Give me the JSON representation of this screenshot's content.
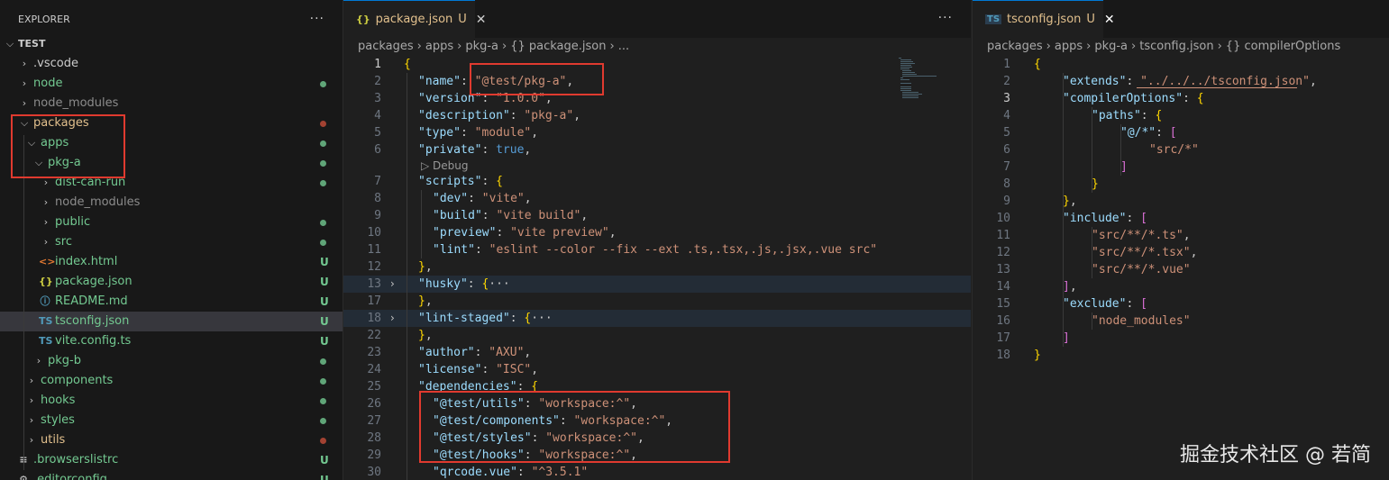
{
  "explorer": {
    "title": "EXPLORER",
    "more": "···",
    "root": "TEST",
    "items": [
      {
        "label": "node",
        "status": "dot"
      },
      {
        "label": "node_modules",
        "status": ""
      },
      {
        "label": "packages",
        "status": "dot"
      },
      {
        "label": "apps",
        "status": "dot"
      },
      {
        "label": "pkg-a",
        "status": "dot"
      },
      {
        "label": "dist-can-run",
        "status": "dot"
      },
      {
        "label": "node_modules",
        "status": ""
      },
      {
        "label": "public",
        "status": "dot"
      },
      {
        "label": "src",
        "status": "dot"
      },
      {
        "label": "index.html",
        "status": "U"
      },
      {
        "label": "package.json",
        "status": "U"
      },
      {
        "label": "README.md",
        "status": "U"
      },
      {
        "label": "tsconfig.json",
        "status": "U"
      },
      {
        "label": "vite.config.ts",
        "status": "U"
      },
      {
        "label": "pkg-b",
        "status": "dot"
      },
      {
        "label": "components",
        "status": "dot"
      },
      {
        "label": "hooks",
        "status": "dot"
      },
      {
        "label": "styles",
        "status": "dot"
      },
      {
        "label": "utils",
        "status": "dot"
      },
      {
        "label": ".browserslistrc",
        "status": "U"
      },
      {
        "label": ".editorconfig",
        "status": "U"
      }
    ],
    "vscode": ".vscode"
  },
  "left_editor": {
    "tab": {
      "icon": "{}",
      "name": "package.json",
      "status": "U",
      "close": "✕"
    },
    "more": "···",
    "breadcrumb": [
      "packages",
      "apps",
      "pkg-a",
      "{} package.json",
      "..."
    ],
    "codelens": "▷ Debug",
    "lines": [
      {
        "n": "1",
        "t": "{"
      },
      {
        "n": "2",
        "t": "\"name\": \"@test/pkg-a\","
      },
      {
        "n": "3",
        "t": "\"version\": \"1.0.0\","
      },
      {
        "n": "4",
        "t": "\"description\": \"pkg-a\","
      },
      {
        "n": "5",
        "t": "\"type\": \"module\","
      },
      {
        "n": "6",
        "t": "\"private\": true,"
      },
      {
        "n": "7",
        "t": "\"scripts\": {"
      },
      {
        "n": "8",
        "t": "\"dev\": \"vite\","
      },
      {
        "n": "9",
        "t": "\"build\": \"vite build\","
      },
      {
        "n": "10",
        "t": "\"preview\": \"vite preview\","
      },
      {
        "n": "11",
        "t": "\"lint\": \"eslint --color --fix --ext .ts,.tsx,.js,.jsx,.vue src\""
      },
      {
        "n": "12",
        "t": "},"
      },
      {
        "n": "13",
        "t": "\"husky\": {···"
      },
      {
        "n": "17",
        "t": "},"
      },
      {
        "n": "18",
        "t": "\"lint-staged\": {···"
      },
      {
        "n": "22",
        "t": "},"
      },
      {
        "n": "23",
        "t": "\"author\": \"AXU\","
      },
      {
        "n": "24",
        "t": "\"license\": \"ISC\","
      },
      {
        "n": "25",
        "t": "\"dependencies\": {"
      },
      {
        "n": "26",
        "t": "\"@test/utils\": \"workspace:^\","
      },
      {
        "n": "27",
        "t": "\"@test/components\": \"workspace:^\","
      },
      {
        "n": "28",
        "t": "\"@test/styles\": \"workspace:^\","
      },
      {
        "n": "29",
        "t": "\"@test/hooks\": \"workspace:^\","
      },
      {
        "n": "30",
        "t": "\"qrcode.vue\": \"^3.5.1\""
      }
    ]
  },
  "right_editor": {
    "tab": {
      "icon": "TS",
      "name": "tsconfig.json",
      "status": "U",
      "close": "✕"
    },
    "breadcrumb": [
      "packages",
      "apps",
      "pkg-a",
      "tsconfig.json",
      "{} compilerOptions"
    ],
    "lines": [
      {
        "n": "1",
        "t": "{"
      },
      {
        "n": "2",
        "t": "\"extends\": \"../../../tsconfig.json\","
      },
      {
        "n": "3",
        "t": "\"compilerOptions\": {"
      },
      {
        "n": "4",
        "t": "\"paths\": {"
      },
      {
        "n": "5",
        "t": "\"@/*\": ["
      },
      {
        "n": "6",
        "t": "\"src/*\""
      },
      {
        "n": "7",
        "t": "]"
      },
      {
        "n": "8",
        "t": "}"
      },
      {
        "n": "9",
        "t": "},"
      },
      {
        "n": "10",
        "t": "\"include\": ["
      },
      {
        "n": "11",
        "t": "\"src/**/*.ts\","
      },
      {
        "n": "12",
        "t": "\"src/**/*.tsx\","
      },
      {
        "n": "13",
        "t": "\"src/**/*.vue\""
      },
      {
        "n": "14",
        "t": "],"
      },
      {
        "n": "15",
        "t": "\"exclude\": ["
      },
      {
        "n": "16",
        "t": "\"node_modules\""
      },
      {
        "n": "17",
        "t": "]"
      },
      {
        "n": "18",
        "t": "}"
      }
    ]
  },
  "watermark": "掘金技术社区 @ 若简",
  "colors": {
    "accent": "#0078d4",
    "untracked": "#73c991",
    "modified": "#e2c08d",
    "deleted": "#c74e39",
    "annotation": "#e03a2f"
  }
}
